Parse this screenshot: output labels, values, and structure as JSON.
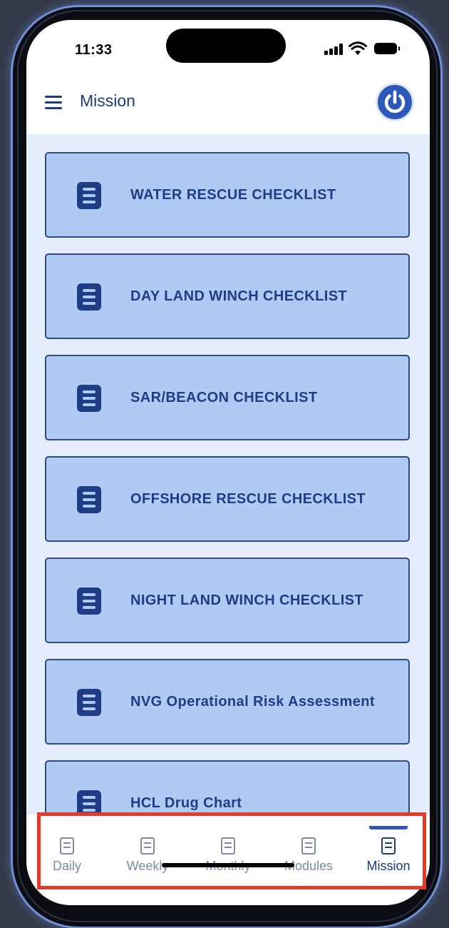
{
  "status_bar": {
    "time": "11:33",
    "icons": [
      "signal-icon",
      "wifi-icon",
      "battery-icon"
    ]
  },
  "header": {
    "title": "Mission",
    "menu_icon": "hamburger-menu-icon",
    "action_icon": "power-icon"
  },
  "checklists": [
    {
      "label": "WATER RESCUE CHECKLIST",
      "icon": "document-icon"
    },
    {
      "label": "DAY LAND WINCH CHECKLIST",
      "icon": "document-icon"
    },
    {
      "label": "SAR/BEACON CHECKLIST",
      "icon": "document-icon"
    },
    {
      "label": "OFFSHORE RESCUE CHECKLIST",
      "icon": "document-icon"
    },
    {
      "label": "NIGHT LAND WINCH CHECKLIST",
      "icon": "document-icon"
    },
    {
      "label": "NVG Operational Risk Assessment",
      "icon": "document-icon"
    },
    {
      "label": "HCL Drug Chart",
      "icon": "document-icon"
    }
  ],
  "tab_bar": {
    "tabs": [
      {
        "label": "Daily",
        "icon": "checklist-icon",
        "active": false
      },
      {
        "label": "Weekly",
        "icon": "checklist-icon",
        "active": false
      },
      {
        "label": "Monthly",
        "icon": "checklist-icon",
        "active": false
      },
      {
        "label": "Modules",
        "icon": "checklist-icon",
        "active": false
      },
      {
        "label": "Mission",
        "icon": "checklist-icon",
        "active": true
      }
    ]
  },
  "colors": {
    "primary": "#1e3a7a",
    "accent": "#2c58b8",
    "card_background": "#b0caf4",
    "content_background": "#e6eefd",
    "inactive_tab": "#7b8aa6",
    "highlight": "#e23b2b"
  }
}
